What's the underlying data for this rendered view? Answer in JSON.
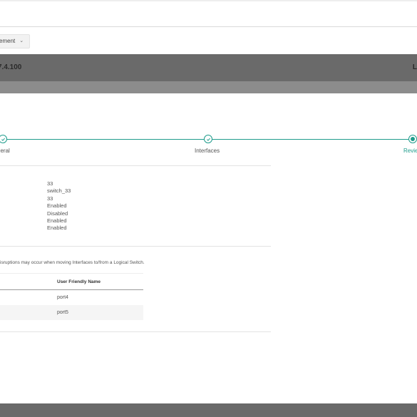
{
  "toolbar": {
    "dropdown_label": "ement"
  },
  "header": {
    "title": "7.4.100",
    "right_label": "L"
  },
  "stepper": {
    "steps": [
      {
        "label": "neral",
        "state": "complete"
      },
      {
        "label": "Interfaces",
        "state": "complete"
      },
      {
        "label": "Revie",
        "state": "active"
      }
    ]
  },
  "summary": {
    "values": [
      "33",
      "switch_33",
      "33",
      "Enabled",
      "Disabled",
      "Enabled",
      "Enabled"
    ]
  },
  "warning_text": "isruptions may occur when moving Interfaces to/from a Logical Switch.",
  "table": {
    "columns": [
      "User Friendly Name"
    ],
    "rows": [
      "port4",
      "port5"
    ]
  },
  "colors": {
    "accent": "#1f9c8c",
    "band": "#6a6a6a"
  },
  "icons": {
    "complete_step": "check-circle-icon",
    "active_step": "radio-active-icon",
    "dropdown": "chevron-down-icon"
  }
}
